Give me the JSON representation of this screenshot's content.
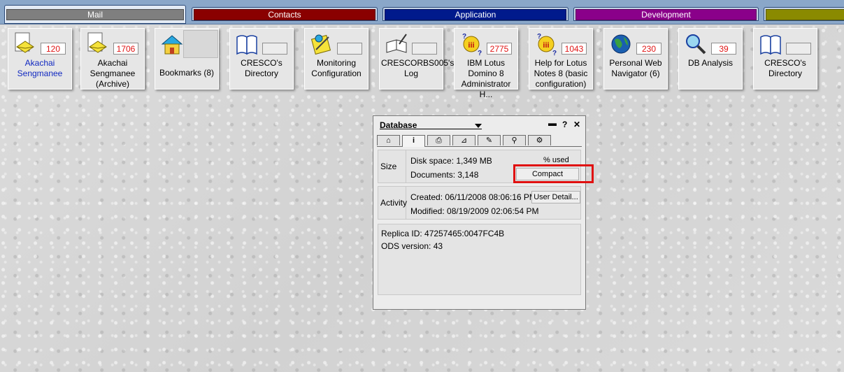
{
  "tabs": [
    {
      "label": "Mail",
      "color": "#7f7f7f",
      "active": true
    },
    {
      "label": "Contacts",
      "color": "#8a0000"
    },
    {
      "label": "Application",
      "color": "#001a8c"
    },
    {
      "label": "Development",
      "color": "#8a008a"
    },
    {
      "label": "",
      "color": "#8a8a00"
    }
  ],
  "tiles": [
    {
      "label": "Akachai Sengmanee",
      "count": "120",
      "icon": "mail-envelope-icon"
    },
    {
      "label": "Akachai Sengmanee (Archive)",
      "count": "1706",
      "icon": "mail-envelope-icon"
    },
    {
      "label": "Bookmarks (8)",
      "count": "",
      "icon": "home-icon"
    },
    {
      "label": "CRESCO's Directory",
      "count": "",
      "icon": "book-icon"
    },
    {
      "label": "Monitoring Configuration",
      "count": "",
      "icon": "configuration-icon"
    },
    {
      "label": "CRESCORBS005's Log",
      "count": "",
      "icon": "log-book-icon"
    },
    {
      "label": "IBM Lotus Domino 8 Administrator H...",
      "count": "2775",
      "icon": "help-icon"
    },
    {
      "label": "Help for Lotus Notes 8 (basic configuration)",
      "count": "1043",
      "icon": "help-icon"
    },
    {
      "label": "Personal Web Navigator (6)",
      "count": "230",
      "icon": "globe-icon"
    },
    {
      "label": "DB Analysis",
      "count": "39",
      "icon": "magnifier-icon"
    },
    {
      "label": "CRESCO's Directory",
      "count": "",
      "icon": "book-icon"
    }
  ],
  "db": {
    "title": "Database",
    "size_label": "Size",
    "disk_space": "Disk space:  1,349 MB",
    "documents": "Documents:  3,148",
    "pct_used": "% used",
    "compact": "Compact",
    "activity_label": "Activity",
    "created": "Created:  06/11/2008 08:06:16 PM",
    "modified": "Modified:  08/19/2009 02:06:54 PM",
    "user_detail": "User Detail...",
    "replica_id": "Replica ID:     47257465:0047FC4B",
    "ods_version": "ODS version:  43"
  },
  "colors": {
    "highlight": "#e01010",
    "count_text": "#e01414"
  }
}
